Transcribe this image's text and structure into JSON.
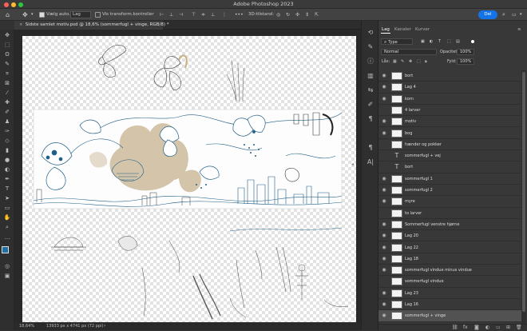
{
  "app": {
    "title": "Adobe Photoshop 2023"
  },
  "options": {
    "auto_select_label": "Vælg auto.:",
    "auto_select_value": "Lag",
    "transform_label": "Vis transform.kontroller",
    "more": "•••",
    "mode_3d": "3D-tilstand:",
    "share": "Del"
  },
  "document": {
    "tab": "Sidste samlet motiv.psd @ 18,6% (sommerfugl + vinge, RGB/8) *",
    "zoom": "18,64%",
    "size": "13933 px x 4741 px (72 ppi)"
  },
  "panel": {
    "tabs": [
      "Lag",
      "Kanaler",
      "Kurver"
    ],
    "filter_kind": "Type",
    "blend_mode": "Normal",
    "opacity_label": "Opacitet:",
    "opacity": "100%",
    "lock_label": "Lås:",
    "fill_label": "Fyld:",
    "fill": "100%"
  },
  "layers": [
    {
      "name": "bort",
      "visible": true,
      "type": "pixel"
    },
    {
      "name": "Lag 4",
      "visible": true,
      "type": "pixel"
    },
    {
      "name": "korn",
      "visible": true,
      "type": "pixel"
    },
    {
      "name": "4 larver",
      "visible": false,
      "type": "pixel"
    },
    {
      "name": "motiv",
      "visible": true,
      "type": "pixel"
    },
    {
      "name": "bog",
      "visible": true,
      "type": "pixel"
    },
    {
      "name": "hænder og pokker",
      "visible": false,
      "type": "pixel"
    },
    {
      "name": "sommerfugl + vej",
      "visible": false,
      "type": "text"
    },
    {
      "name": "bort",
      "visible": false,
      "type": "text"
    },
    {
      "name": "sommerfugl 1",
      "visible": true,
      "type": "pixel"
    },
    {
      "name": "sommerfugl 2",
      "visible": true,
      "type": "pixel"
    },
    {
      "name": "myre",
      "visible": true,
      "type": "pixel"
    },
    {
      "name": "to larver",
      "visible": false,
      "type": "pixel"
    },
    {
      "name": "Sommerfugl venstre hjørne",
      "visible": true,
      "type": "pixel"
    },
    {
      "name": "Lag 20",
      "visible": true,
      "type": "pixel"
    },
    {
      "name": "Lag 22",
      "visible": true,
      "type": "pixel"
    },
    {
      "name": "Lag 18",
      "visible": true,
      "type": "pixel"
    },
    {
      "name": "sommerfugl vindue minus vindue",
      "visible": true,
      "type": "pixel"
    },
    {
      "name": "sommerfugl vindue",
      "visible": false,
      "type": "pixel"
    },
    {
      "name": "Lag 23",
      "visible": true,
      "type": "pixel"
    },
    {
      "name": "Lag 16",
      "visible": true,
      "type": "pixel"
    },
    {
      "name": "sommerfugl + vinge",
      "visible": true,
      "type": "pixel",
      "selected": true
    }
  ],
  "colors": {
    "accent": "#1473e6",
    "ink": "#1f5f86",
    "beige": "#cdbb9c"
  }
}
